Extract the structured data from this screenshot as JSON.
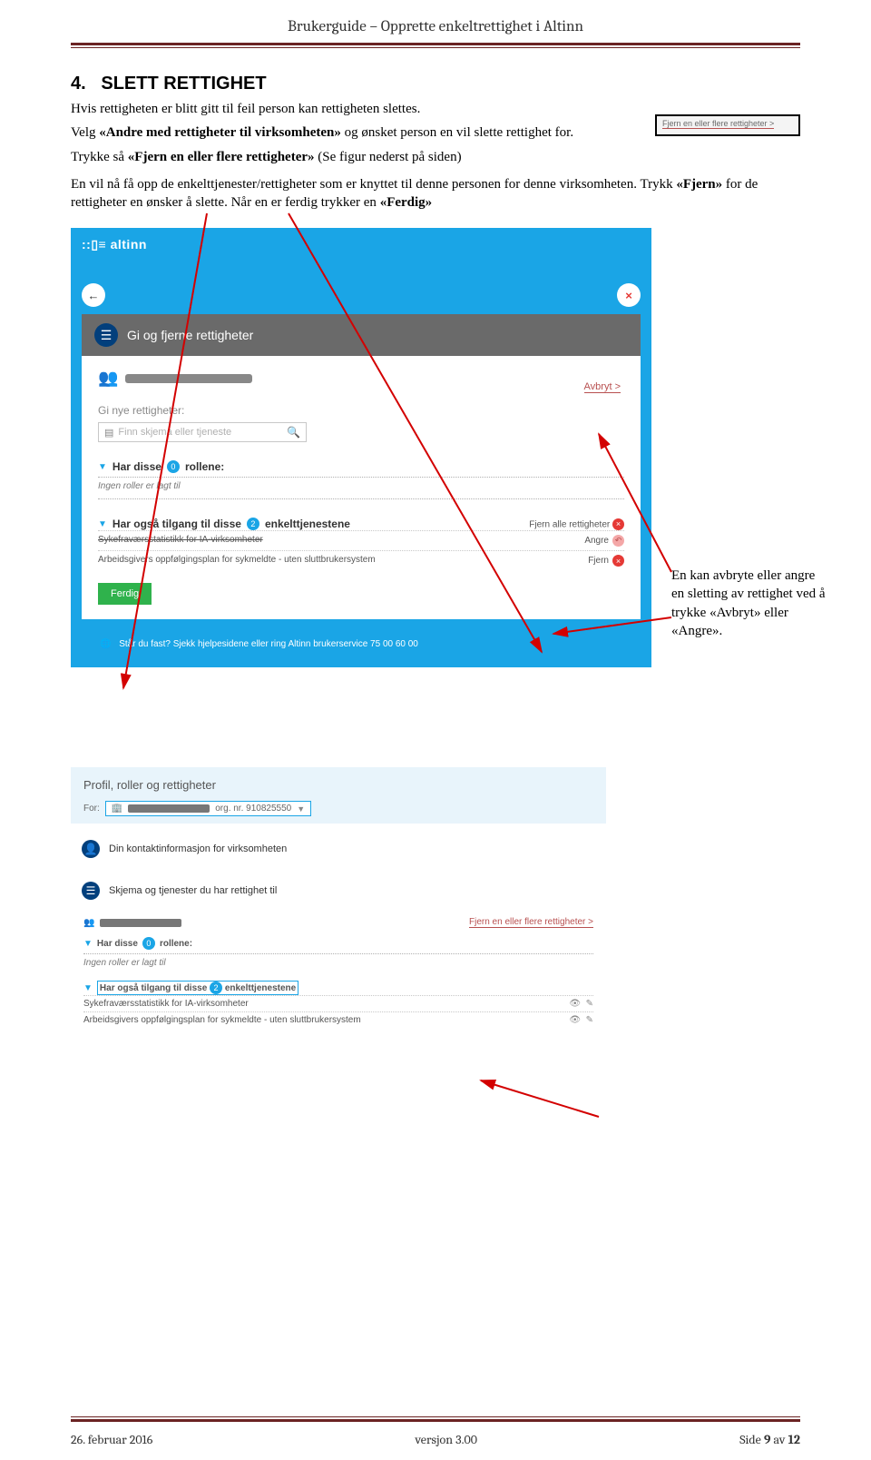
{
  "header": {
    "title": "Brukerguide – Opprette enkeltrettighet i Altinn"
  },
  "section": {
    "number": "4.",
    "title": "SLETT RETTIGHET",
    "p1a": "Hvis rettigheten er blitt gitt til feil person kan rettigheten slettes.",
    "p1b": "Velg «Andre med rettigheter til virksomheten» og ønsket person en vil slette rettighet for.",
    "p1c": "Trykke så «Fjern en eller flere rettigheter»  (Se figur nederst på siden)",
    "p2": "En vil nå få opp de enkelttjenester/rettigheter som er knyttet til denne personen for denne virksomheten. Trykk «Fjern» for de rettigheter en ønsker å slette. Når en er ferdig trykker en «Ferdig»",
    "chip": "Fjern en eller flere rettigheter >"
  },
  "shot1": {
    "logo": "altinn",
    "back": "←",
    "close": "×",
    "head": "Gi og fjerne rettigheter",
    "avbryt": "Avbryt >",
    "give": "Gi nye rettigheter:",
    "search_ph": "Finn skjema eller tjeneste",
    "roles_label_a": "Har disse",
    "roles_badge": "0",
    "roles_label_b": "rollene:",
    "no_roles": "Ingen roller er lagt til",
    "also_a": "Har også tilgang til disse",
    "also_badge": "2",
    "also_b": "enkelttjenestene",
    "fjern_all": "Fjern alle rettigheter",
    "row1": "Sykefraværsstatistikk for IA-virksomheter",
    "row1_act": "Angre",
    "row2": "Arbeidsgivers oppfølgingsplan for sykmeldte - uten sluttbrukersystem",
    "row2_act": "Fjern",
    "ferdig": "Ferdig",
    "help": "Står du fast? Sjekk hjelpesidene eller ring Altinn brukerservice 75 00 60 00"
  },
  "callout": {
    "text": "En kan avbryte eller angre en sletting av rettighet ved å trykke «Avbryt» eller «Angre»."
  },
  "shot2": {
    "title": "Profil, roller og rettigheter",
    "for": "For:",
    "org": "org. nr. 910825550",
    "contact": "Din kontaktinformasjon for virksomheten",
    "forms": "Skjema og tjenester du har rettighet til",
    "fjern_link": "Fjern en eller flere rettigheter >",
    "roles_a": "Har disse",
    "roles_badge": "0",
    "roles_b": "rollene:",
    "no_roles": "Ingen roller er lagt til",
    "also_a": "Har også tilgang til disse",
    "also_badge": "2",
    "also_b": "enkelttjenestene",
    "r1": "Sykefraværsstatistikk for IA-virksomheter",
    "r2": "Arbeidsgivers oppfølgingsplan for sykmeldte - uten sluttbrukersystem"
  },
  "footer": {
    "left": "26. februar 2016",
    "center": "versjon 3.00",
    "right_a": "Side ",
    "right_b": "9",
    "right_c": " av ",
    "right_d": "12"
  }
}
